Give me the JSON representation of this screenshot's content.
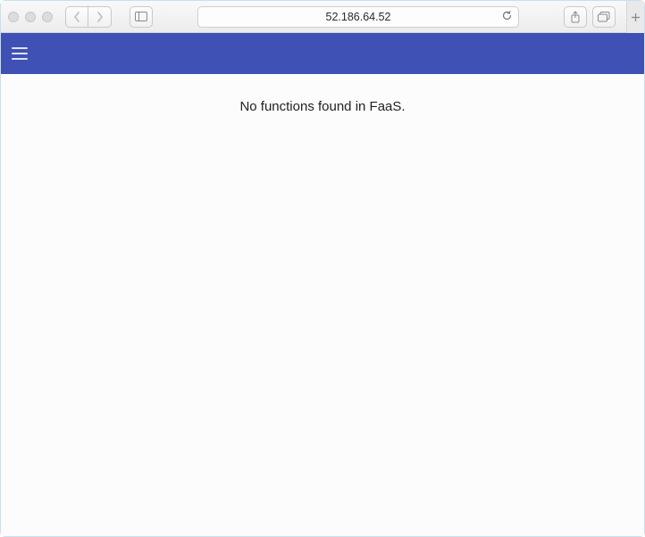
{
  "browser": {
    "address": "52.186.64.52"
  },
  "app": {
    "empty_message": "No functions found in FaaS."
  }
}
